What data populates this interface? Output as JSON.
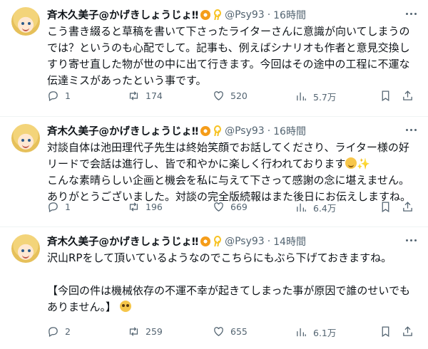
{
  "tweets": [
    {
      "name": "斉木久美子@かげきしょうじょ‼",
      "handle": "@Psy93",
      "sep": "·",
      "time": "16時間",
      "lines": [
        "こう書き綴ると草稿を書いて下さったライターさんに意識が向いてしまうの",
        "では？というのも心配でして。記事も、例えばシナリオも作者と意見交換し",
        "すり寄せ直した物が世の中に出て行きます。今回はその途中の工程に不運な",
        "伝達ミスがあったという事です。"
      ],
      "replies": "1",
      "retweets": "174",
      "likes": "520",
      "views": "5.7万"
    },
    {
      "name": "斉木久美子@かげきしょうじょ‼",
      "handle": "@Psy93",
      "sep": "·",
      "time": "16時間",
      "lines": [
        "対談自体は池田理代子先生は終始笑顔でお話してくださり、ライター様の好",
        "リードで会話は進行し、皆で和やかに楽しく行われております",
        "こんな素晴らしい企画と機会を私に与えて下さって感謝の念に堪えません。",
        "ありがとうございました。対談の完全版続報はまた後日にお伝えしますね。"
      ],
      "replies": "1",
      "retweets": "196",
      "likes": "669",
      "views": "6.4万"
    },
    {
      "name": "斉木久美子@かげきしょうじょ‼",
      "handle": "@Psy93",
      "sep": "·",
      "time": "14時間",
      "lines": [
        "沢山RPをして頂いているようなのでこちらにもぶら下げておきますね。",
        "【今回の件は機械依存の不運不幸が起きてしまった事が原因で誰のせいでも",
        "ありません。】"
      ],
      "replies": "2",
      "retweets": "259",
      "likes": "655",
      "views": "6.1万"
    }
  ],
  "icons": {
    "more": "more-icon",
    "reply": "reply-icon",
    "retweet": "retweet-icon",
    "like": "heart-icon",
    "views": "views-icon",
    "bookmark": "bookmark-icon",
    "share": "share-icon"
  },
  "colors": {
    "text": "#0f1419",
    "secondary": "#536471",
    "divider": "#eff3f4"
  }
}
